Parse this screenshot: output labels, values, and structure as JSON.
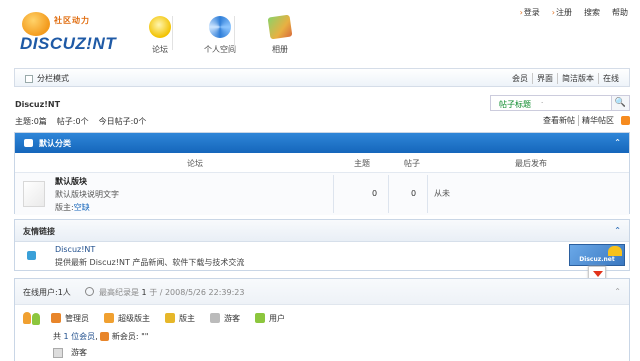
{
  "logo": {
    "tagline": "社区动力",
    "wordmark": "DISCUZ!NT"
  },
  "nav": [
    {
      "label": "论坛",
      "icon": "forum-icon"
    },
    {
      "label": "个人空间",
      "icon": "space-icon"
    },
    {
      "label": "相册",
      "icon": "album-icon"
    }
  ],
  "toplinks": {
    "login": "登录",
    "register": "注册",
    "search": "搜索",
    "help": "帮助"
  },
  "menubar": {
    "mode_label": "分栏模式",
    "links": [
      "会员",
      "界面",
      "简洁版本",
      "在线"
    ]
  },
  "site": {
    "name": "Discuz!NT",
    "stats": {
      "topics": "主题:0篇",
      "posts": "帖子:0个",
      "today": "今日帖子:0个"
    }
  },
  "search": {
    "placeholder": "帖子标题",
    "dropdown": "·",
    "button": "🔍"
  },
  "sublinks": {
    "new": "查看新帖",
    "digest": "精华帖区"
  },
  "category": {
    "title": "默认分类",
    "collapse": "⌃",
    "columns": {
      "forum": "论坛",
      "topics": "主题",
      "posts": "帖子",
      "last": "最后发布"
    },
    "forums": [
      {
        "name": "默认版块",
        "desc": "默认版块说明文字",
        "mod_prefix": "版主:",
        "mod_name": "空缺",
        "topics": "0",
        "posts": "0",
        "last": "从未"
      }
    ]
  },
  "links": {
    "title": "友情链接",
    "collapse": "⌃",
    "items": [
      {
        "name": "Discuz!NT",
        "desc": "提供最新 Discuz!NT 产品新闻、软件下载与技术交流",
        "banner": "Discuz.net"
      }
    ]
  },
  "online": {
    "title": "在线用户:1人",
    "record_prefix": "最高纪录是",
    "record_count": "1",
    "record_suffix": "于",
    "record_time": "2008/5/26 22:39:23",
    "collapse": "⌃",
    "legend": [
      {
        "label": "管理员",
        "color": "#e8852a"
      },
      {
        "label": "超级版主",
        "color": "#f0a030"
      },
      {
        "label": "版主",
        "color": "#e6b72a"
      },
      {
        "label": "游客",
        "color": "#bbbbbb"
      },
      {
        "label": "用户",
        "color": "#8cc63e"
      }
    ],
    "summary_prefix": "共",
    "summary_count": "1 位会员",
    "summary_new": "新会员: \"\"",
    "users": [
      "游客"
    ]
  },
  "colors": {
    "header_blue": "#1566bb",
    "accent_orange": "#e07020",
    "link_blue": "#1f4e8c"
  }
}
